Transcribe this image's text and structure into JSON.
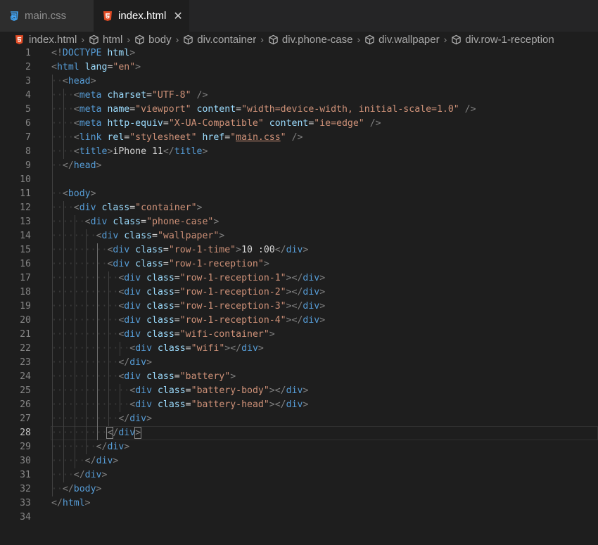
{
  "tabs": [
    {
      "label": "main.css",
      "icon": "css3-icon",
      "active": false
    },
    {
      "label": "index.html",
      "icon": "html5-icon",
      "active": true,
      "close": "✕"
    }
  ],
  "breadcrumb": [
    "index.html",
    "html",
    "body",
    "div.container",
    "div.phone-case",
    "div.wallpaper",
    "div.row-1-reception"
  ],
  "breadcrumb_separator": "›",
  "current_line": 28,
  "lines": [
    {
      "n": "1",
      "indent": 0,
      "html": "<span class='t-punc'>&lt;!</span><span class='t-doctype'>DOCTYPE</span> <span class='t-attr'>html</span><span class='t-punc'>&gt;</span>"
    },
    {
      "n": "2",
      "indent": 0,
      "html": "<span class='t-punc'>&lt;</span><span class='t-tag'>html</span> <span class='t-attr'>lang</span>=<span class='t-str'>\"en\"</span><span class='t-punc'>&gt;</span>"
    },
    {
      "n": "3",
      "indent": 1,
      "html": "<span class='t-punc'>&lt;</span><span class='t-tag'>head</span><span class='t-punc'>&gt;</span>"
    },
    {
      "n": "4",
      "indent": 2,
      "html": "<span class='t-punc'>&lt;</span><span class='t-tag'>meta</span> <span class='t-attr'>charset</span>=<span class='t-str'>\"UTF-8\"</span> <span class='t-punc'>/&gt;</span>"
    },
    {
      "n": "5",
      "indent": 2,
      "html": "<span class='t-punc'>&lt;</span><span class='t-tag'>meta</span> <span class='t-attr'>name</span>=<span class='t-str'>\"viewport\"</span> <span class='t-attr'>content</span>=<span class='t-str'>\"width=device-width, initial-scale=1.0\"</span> <span class='t-punc'>/&gt;</span>"
    },
    {
      "n": "6",
      "indent": 2,
      "html": "<span class='t-punc'>&lt;</span><span class='t-tag'>meta</span> <span class='t-attr'>http-equiv</span>=<span class='t-str'>\"X-UA-Compatible\"</span> <span class='t-attr'>content</span>=<span class='t-str'>\"ie=edge\"</span> <span class='t-punc'>/&gt;</span>"
    },
    {
      "n": "7",
      "indent": 2,
      "html": "<span class='t-punc'>&lt;</span><span class='t-tag'>link</span> <span class='t-attr'>rel</span>=<span class='t-str'>\"stylesheet\"</span> <span class='t-attr'>href</span>=<span class='t-str'>\"<u class='link'>main.css</u>\"</span> <span class='t-punc'>/&gt;</span>"
    },
    {
      "n": "8",
      "indent": 2,
      "html": "<span class='t-punc'>&lt;</span><span class='t-tag'>title</span><span class='t-punc'>&gt;</span><span class='t-text'>iPhone 11</span><span class='t-punc'>&lt;/</span><span class='t-tag'>title</span><span class='t-punc'>&gt;</span>"
    },
    {
      "n": "9",
      "indent": 1,
      "html": "<span class='t-punc'>&lt;/</span><span class='t-tag'>head</span><span class='t-punc'>&gt;</span>"
    },
    {
      "n": "10",
      "indent": 0,
      "html": ""
    },
    {
      "n": "11",
      "indent": 1,
      "html": "<span class='t-punc'>&lt;</span><span class='t-tag'>body</span><span class='t-punc'>&gt;</span>"
    },
    {
      "n": "12",
      "indent": 2,
      "html": "<span class='t-punc'>&lt;</span><span class='t-tag'>div</span> <span class='t-attr'>class</span>=<span class='t-str'>\"container\"</span><span class='t-punc'>&gt;</span>"
    },
    {
      "n": "13",
      "indent": 3,
      "html": "<span class='t-punc'>&lt;</span><span class='t-tag'>div</span> <span class='t-attr'>class</span>=<span class='t-str'>\"phone-case\"</span><span class='t-punc'>&gt;</span>"
    },
    {
      "n": "14",
      "indent": 4,
      "html": "<span class='t-punc'>&lt;</span><span class='t-tag'>div</span> <span class='t-attr'>class</span>=<span class='t-str'>\"wallpaper\"</span><span class='t-punc'>&gt;</span>"
    },
    {
      "n": "15",
      "indent": 5,
      "html": "<span class='t-punc'>&lt;</span><span class='t-tag'>div</span> <span class='t-attr'>class</span>=<span class='t-str'>\"row-1-time\"</span><span class='t-punc'>&gt;</span><span class='t-text'>10 :00</span><span class='t-punc'>&lt;/</span><span class='t-tag'>div</span><span class='t-punc'>&gt;</span>"
    },
    {
      "n": "16",
      "indent": 5,
      "html": "<span class='t-punc'>&lt;</span><span class='t-tag'>div</span> <span class='t-attr'>class</span>=<span class='t-str'>\"row-1-reception\"</span><span class='t-punc'>&gt;</span>"
    },
    {
      "n": "17",
      "indent": 6,
      "html": "<span class='t-punc'>&lt;</span><span class='t-tag'>div</span> <span class='t-attr'>class</span>=<span class='t-str'>\"row-1-reception-1\"</span><span class='t-punc'>&gt;&lt;/</span><span class='t-tag'>div</span><span class='t-punc'>&gt;</span>"
    },
    {
      "n": "18",
      "indent": 6,
      "html": "<span class='t-punc'>&lt;</span><span class='t-tag'>div</span> <span class='t-attr'>class</span>=<span class='t-str'>\"row-1-reception-2\"</span><span class='t-punc'>&gt;&lt;/</span><span class='t-tag'>div</span><span class='t-punc'>&gt;</span>"
    },
    {
      "n": "19",
      "indent": 6,
      "html": "<span class='t-punc'>&lt;</span><span class='t-tag'>div</span> <span class='t-attr'>class</span>=<span class='t-str'>\"row-1-reception-3\"</span><span class='t-punc'>&gt;&lt;/</span><span class='t-tag'>div</span><span class='t-punc'>&gt;</span>"
    },
    {
      "n": "20",
      "indent": 6,
      "html": "<span class='t-punc'>&lt;</span><span class='t-tag'>div</span> <span class='t-attr'>class</span>=<span class='t-str'>\"row-1-reception-4\"</span><span class='t-punc'>&gt;&lt;/</span><span class='t-tag'>div</span><span class='t-punc'>&gt;</span>"
    },
    {
      "n": "21",
      "indent": 6,
      "html": "<span class='t-punc'>&lt;</span><span class='t-tag'>div</span> <span class='t-attr'>class</span>=<span class='t-str'>\"wifi-container\"</span><span class='t-punc'>&gt;</span>"
    },
    {
      "n": "22",
      "indent": 7,
      "html": "<span class='t-punc'>&lt;</span><span class='t-tag'>div</span> <span class='t-attr'>class</span>=<span class='t-str'>\"wifi\"</span><span class='t-punc'>&gt;&lt;/</span><span class='t-tag'>div</span><span class='t-punc'>&gt;</span>"
    },
    {
      "n": "23",
      "indent": 6,
      "html": "<span class='t-punc'>&lt;/</span><span class='t-tag'>div</span><span class='t-punc'>&gt;</span>"
    },
    {
      "n": "24",
      "indent": 6,
      "html": "<span class='t-punc'>&lt;</span><span class='t-tag'>div</span> <span class='t-attr'>class</span>=<span class='t-str'>\"battery\"</span><span class='t-punc'>&gt;</span>"
    },
    {
      "n": "25",
      "indent": 7,
      "html": "<span class='t-punc'>&lt;</span><span class='t-tag'>div</span> <span class='t-attr'>class</span>=<span class='t-str'>\"battery-body\"</span><span class='t-punc'>&gt;&lt;/</span><span class='t-tag'>div</span><span class='t-punc'>&gt;</span>"
    },
    {
      "n": "26",
      "indent": 7,
      "html": "<span class='t-punc'>&lt;</span><span class='t-tag'>div</span> <span class='t-attr'>class</span>=<span class='t-str'>\"battery-head\"</span><span class='t-punc'>&gt;&lt;/</span><span class='t-tag'>div</span><span class='t-punc'>&gt;</span>"
    },
    {
      "n": "27",
      "indent": 6,
      "html": "<span class='t-punc'>&lt;/</span><span class='t-tag'>div</span><span class='t-punc'>&gt;</span>"
    },
    {
      "n": "28",
      "indent": 5,
      "html": "<span class='t-punc cursorbox'>&lt;</span><span class='t-punc'>/</span><span class='t-tag'>div</span><span class='t-punc cursorbox'>&gt;</span>"
    },
    {
      "n": "29",
      "indent": 4,
      "html": "<span class='t-punc'>&lt;/</span><span class='t-tag'>div</span><span class='t-punc'>&gt;</span>"
    },
    {
      "n": "30",
      "indent": 3,
      "html": "<span class='t-punc'>&lt;/</span><span class='t-tag'>div</span><span class='t-punc'>&gt;</span>"
    },
    {
      "n": "31",
      "indent": 2,
      "html": "<span class='t-punc'>&lt;/</span><span class='t-tag'>div</span><span class='t-punc'>&gt;</span>"
    },
    {
      "n": "32",
      "indent": 1,
      "html": "<span class='t-punc'>&lt;/</span><span class='t-tag'>body</span><span class='t-punc'>&gt;</span>"
    },
    {
      "n": "33",
      "indent": 0,
      "html": "<span class='t-punc'>&lt;/</span><span class='t-tag'>html</span><span class='t-punc'>&gt;</span>"
    },
    {
      "n": "34",
      "indent": 0,
      "html": ""
    }
  ],
  "colors": {
    "tag": "#569cd6",
    "attr": "#9cdcfe",
    "string": "#ce9178",
    "text": "#d4d4d4",
    "css_icon": "#42a5f5",
    "html_icon": "#e44d26"
  }
}
